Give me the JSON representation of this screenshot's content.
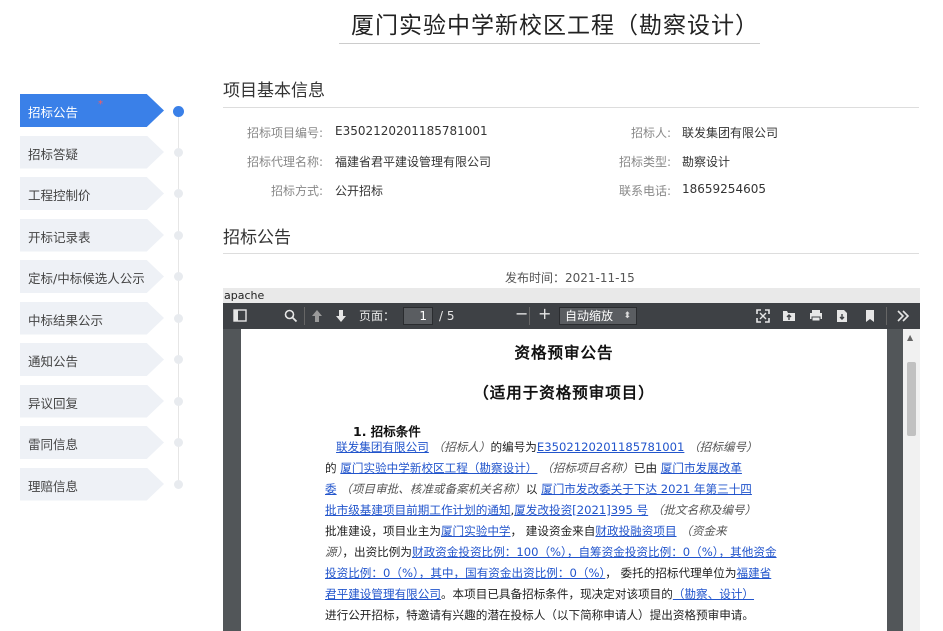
{
  "page_title": "厦门实验中学新校区工程（勘察设计）",
  "nav": [
    {
      "label": "招标公告",
      "active": true,
      "star": "*"
    },
    {
      "label": "招标答疑"
    },
    {
      "label": "工程控制价"
    },
    {
      "label": "开标记录表"
    },
    {
      "label": "定标/中标候选人公示"
    },
    {
      "label": "中标结果公示"
    },
    {
      "label": "通知公告"
    },
    {
      "label": "异议回复"
    },
    {
      "label": "雷同信息"
    },
    {
      "label": "理赔信息"
    }
  ],
  "basic_info": {
    "title": "项目基本信息",
    "project_no_label": "招标项目编号:",
    "project_no": "E3502120201185781001",
    "tenderer_label": "招标人:",
    "tenderer": "联发集团有限公司",
    "agency_label": "招标代理名称:",
    "agency": "福建省君平建设管理有限公司",
    "type_label": "招标类型:",
    "type": "勘察设计",
    "method_label": "招标方式:",
    "method": "公开招标",
    "phone_label": "联系电话:",
    "phone": "18659254605"
  },
  "announcement": {
    "title": "招标公告",
    "publish_label": "发布时间：",
    "publish_date": "2021-11-15"
  },
  "viewer": {
    "apache": "apache",
    "page_label": "页面：",
    "page_current": "1",
    "page_total": "/ 5",
    "zoom": "自动缩放",
    "minus": "−",
    "plus": "+",
    "doc_title": "资格预审公告",
    "doc_subtitle": "（适用于资格预审项目）",
    "section_heading": "1.  招标条件",
    "lines": {
      "l1a": "联发集团有限公司",
      "l1b": "（招标人）",
      "l1c": "的编号为",
      "l1d": "E3502120201185781001",
      "l1e": "（招标编号）",
      "l2a": "的",
      "l2b": "厦门实验中学新校区工程（勘察设计）",
      "l2c": "（招标项目名称）",
      "l2d": "已由",
      "l2e": "厦门市发展改革",
      "l3a": "委",
      "l3b": "（项目审批、核准或备案机关名称）",
      "l3c": "以",
      "l3d": "厦门市发改委关于下达 2021 年第三十四",
      "l4a": "批市级基建项目前期工作计划的通知",
      "l4b": "厦发改投资[2021]395 号",
      "l4c": "（批文名称及编号）",
      "l5a": "批准建设，项目业主为",
      "l5b": "厦门实验中学",
      "l5c": "，  建设资金来自",
      "l5d": "财政投融资项目",
      "l5e": "（资金来",
      "l6a": "源）",
      "l6b": "，出资比例为",
      "l6c": "财政资金投资比例：100（%），自筹资金投资比例：0（%），其他资金",
      "l7a": "投资比例：0（%），其中，国有资金出资比例：0（%）",
      "l7b": "，  委托的招标代理单位为",
      "l7c": "福建省",
      "l8a": "君平建设管理有限公司",
      "l8b": "。本项目已具备招标条件，现决定对该项目的",
      "l8c": "（勘察、设计）",
      "l9a": "进行公开招标，特邀请有兴趣的潜在投标人（以下简称申请人）提出资格预审申请。"
    }
  },
  "colors": {
    "accent": "#3a80e8",
    "nav_bg": "#eef1f6",
    "link": "#2255cc",
    "toolbar": "#3e4145"
  }
}
